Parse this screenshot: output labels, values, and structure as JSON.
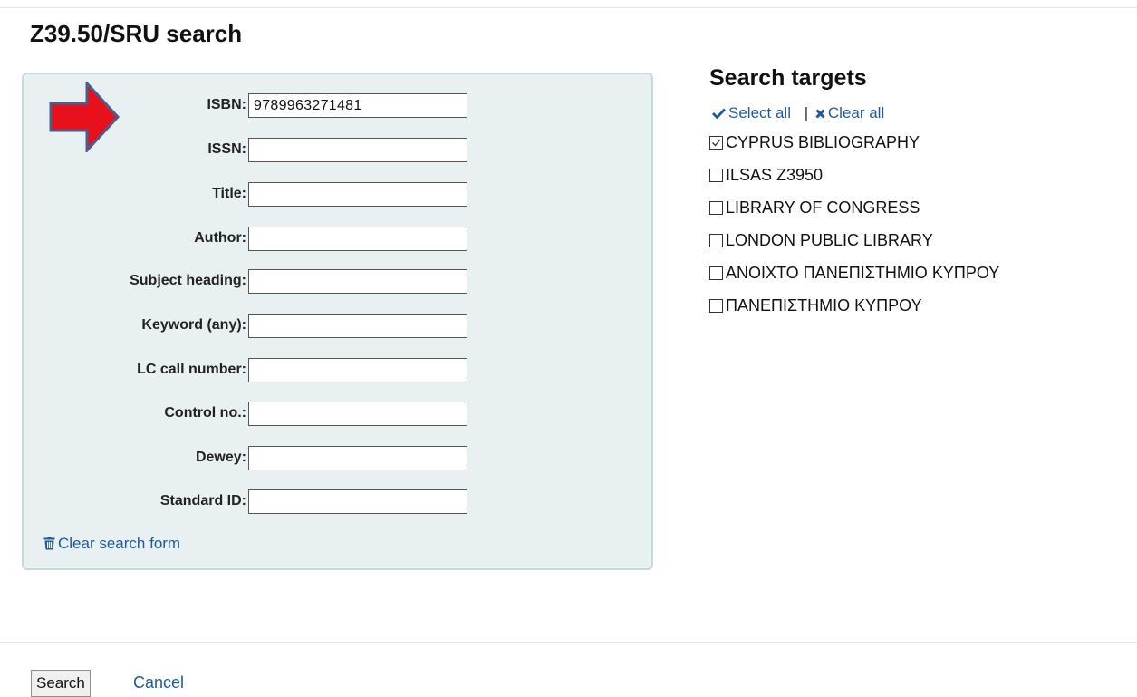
{
  "page": {
    "title": "Z39.50/SRU search"
  },
  "form": {
    "fields": [
      {
        "label": "ISBN:",
        "value": "9789963271481"
      },
      {
        "label": "ISSN:",
        "value": ""
      },
      {
        "label": "Title:",
        "value": ""
      },
      {
        "label": "Author:",
        "value": ""
      },
      {
        "label": "Subject heading:",
        "value": ""
      },
      {
        "label": "Keyword (any):",
        "value": ""
      },
      {
        "label": "LC call number:",
        "value": ""
      },
      {
        "label": "Control no.:",
        "value": ""
      },
      {
        "label": "Dewey:",
        "value": ""
      },
      {
        "label": "Standard ID:",
        "value": ""
      }
    ],
    "clear_label": "Clear search form"
  },
  "annotation": {
    "arrow_color": "#e8101b",
    "arrow_outline": "#4a5d8c"
  },
  "targets": {
    "heading": "Search targets",
    "select_all": "Select all",
    "separator": "|",
    "clear_all": "Clear all",
    "items": [
      {
        "label": "CYPRUS BIBLIOGRAPHY",
        "checked": true
      },
      {
        "label": "ILSAS Z3950",
        "checked": false
      },
      {
        "label": "LIBRARY OF CONGRESS",
        "checked": false
      },
      {
        "label": "LONDON PUBLIC LIBRARY",
        "checked": false
      },
      {
        "label": "ΑΝΟΙΧΤΟ ΠΑΝΕΠΙΣΤΗΜΙΟ ΚΥΠΡΟΥ",
        "checked": false
      },
      {
        "label": "ΠΑΝΕΠΙΣΤΗΜΙΟ ΚΥΠΡΟΥ",
        "checked": false
      }
    ]
  },
  "actions": {
    "search_label": "Search",
    "cancel_label": "Cancel"
  },
  "colors": {
    "link": "#1f5b9c",
    "panel_bg": "#e8f0f2",
    "panel_border": "#c2dbe0"
  }
}
